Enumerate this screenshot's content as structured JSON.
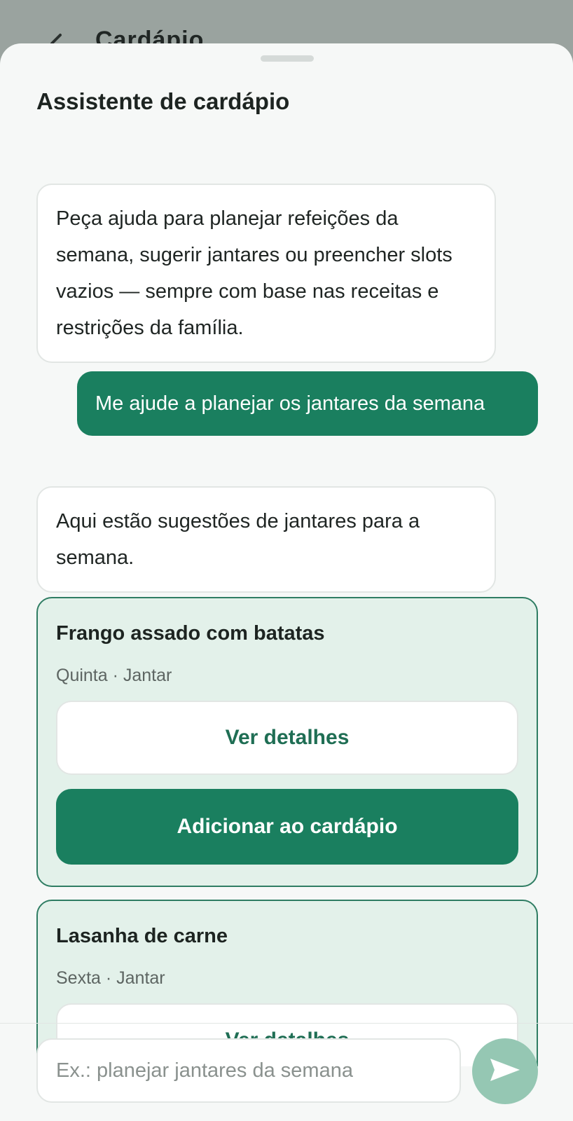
{
  "background": {
    "title": "Cardápio"
  },
  "sheet": {
    "title": "Assistente de cardápio"
  },
  "messages": {
    "intro": "Peça ajuda para planejar refeições da semana, sugerir jantares ou preencher slots vazios — sempre com base nas receitas e restrições da família.",
    "user_request": "Me ajude a planejar os jantares da semana",
    "ai_reply": "Aqui estão sugestões de jantares para a semana."
  },
  "suggestions": [
    {
      "title": "Frango assado com batatas",
      "subtitle": "Quinta · Jantar",
      "details_label": "Ver detalhes",
      "add_label": "Adicionar ao cardápio"
    },
    {
      "title": "Lasanha de carne",
      "subtitle": "Sexta · Jantar",
      "details_label": "Ver detalhes"
    }
  ],
  "composer": {
    "placeholder": "Ex.: planejar jantares da semana"
  },
  "icons": {
    "back": "back-arrow-icon",
    "send": "send-icon"
  },
  "colors": {
    "accent": "#1a7f5f",
    "card_background": "#e3f1ea",
    "send_disabled": "#95c7b3"
  }
}
